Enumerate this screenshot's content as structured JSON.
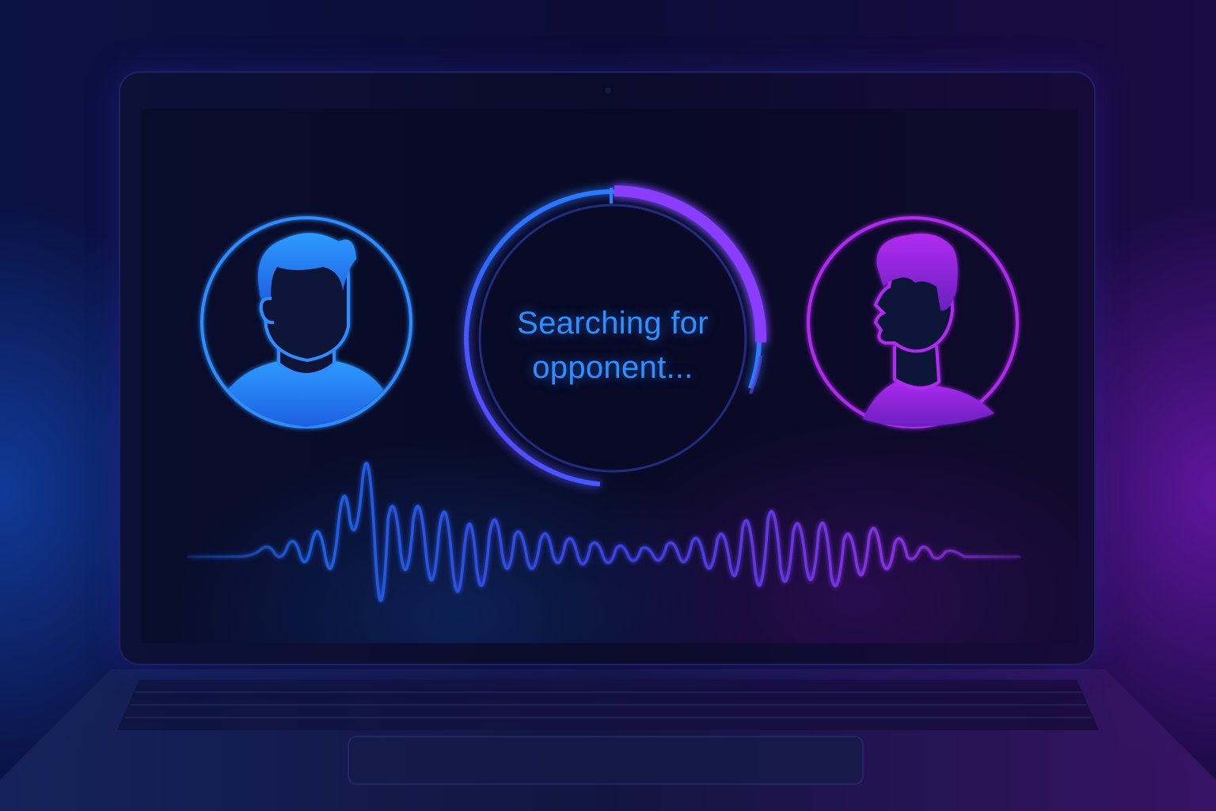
{
  "matchmaking": {
    "status_line1": "Searching for",
    "status_line2": "opponent...",
    "player": {
      "icon": "user-silhouette-icon",
      "color": "#2d8cff"
    },
    "opponent": {
      "icon": "user-profile-silhouette-icon",
      "color": "#b02cf0"
    },
    "spinner": {
      "track_color": "#2d7dff",
      "arc_color": "#8a3cff"
    },
    "waveform": {
      "start_color": "#1f5fe0",
      "end_color": "#8a2fe0"
    }
  }
}
